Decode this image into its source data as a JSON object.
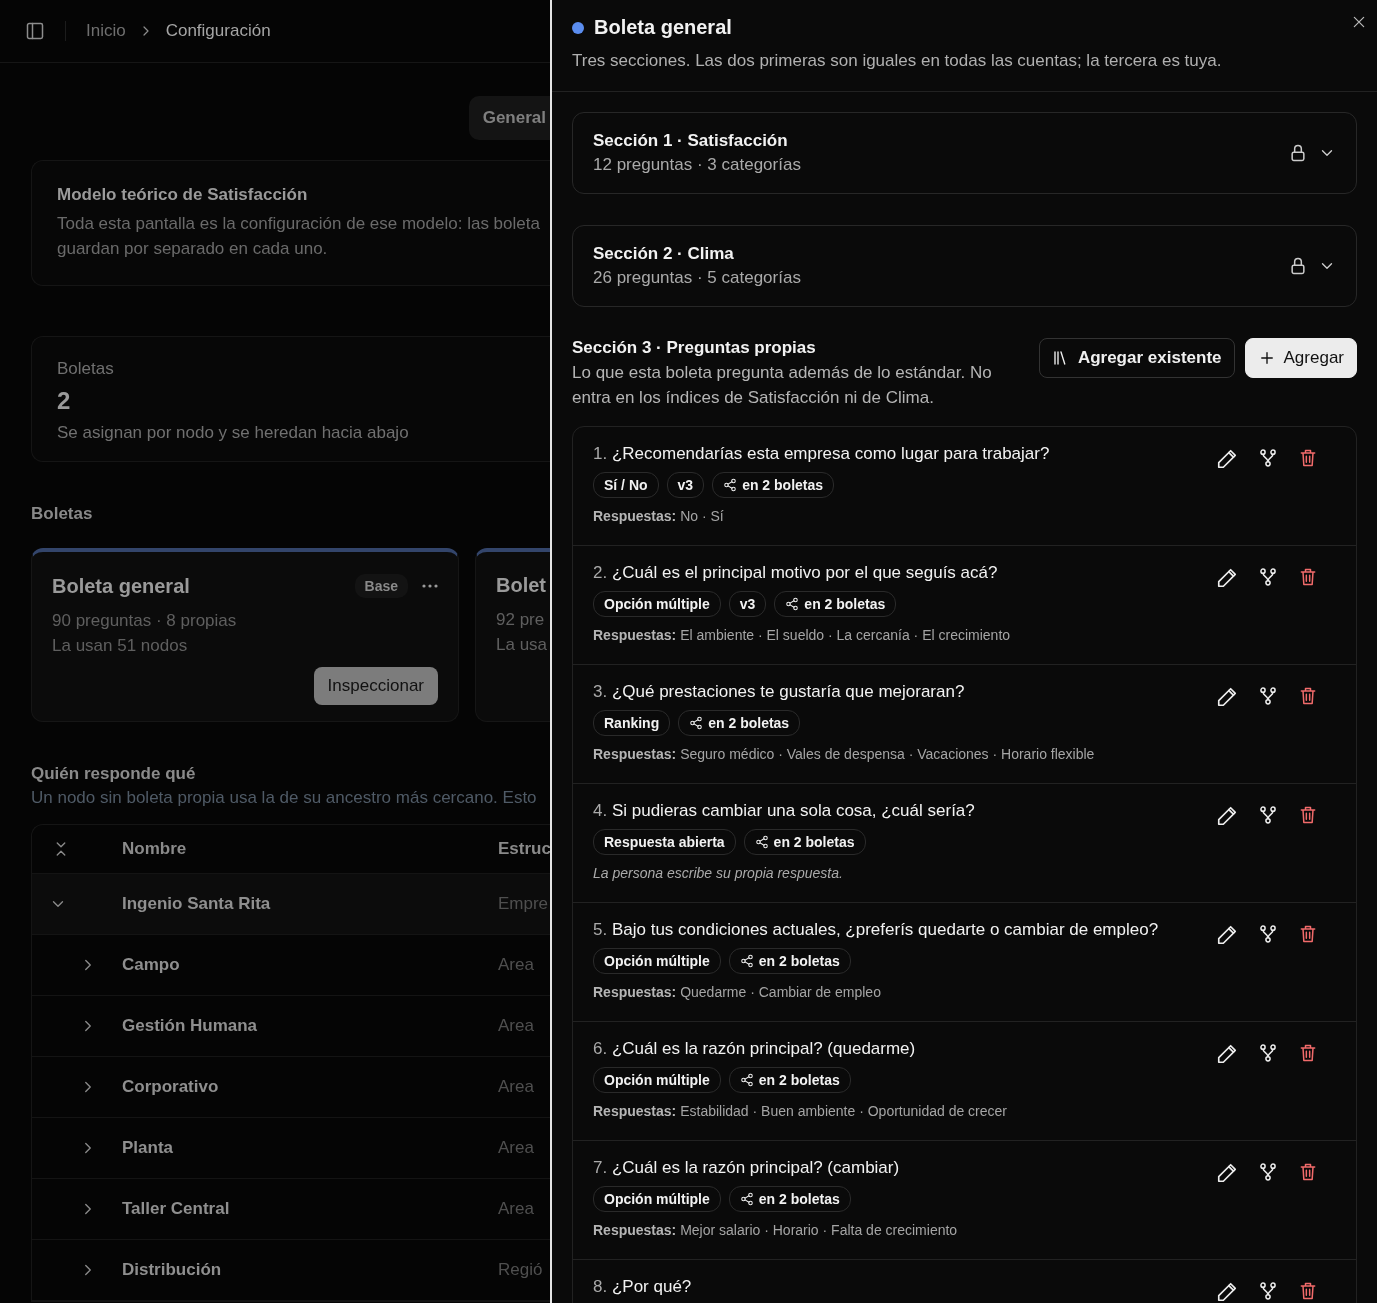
{
  "header": {
    "breadcrumbs": [
      "Inicio",
      "Configuración"
    ]
  },
  "view_tab": {
    "label": "General"
  },
  "model_card": {
    "title": "Modelo teórico de Satisfacción",
    "lines": [
      "Toda esta pantalla es la configuración de ese modelo: las boleta",
      "guardan por separado en cada uno."
    ]
  },
  "stat_card": {
    "label": "Boletas",
    "value": "2",
    "note": "Se asignan por nodo y se heredan hacia abajo"
  },
  "ballots_heading": "Boletas",
  "ballots": [
    {
      "title": "Boleta general",
      "badge": "Base",
      "meta": [
        "90 preguntas · 8 propias",
        "La usan 51 nodos"
      ],
      "action": "Inspeccionar"
    },
    {
      "title": "Bolet",
      "meta": [
        "92 pre",
        "La usa"
      ]
    }
  ],
  "assignments": {
    "title": "Quién responde qué",
    "description": "Un nodo sin boleta propia usa la de su ancestro más cercano. Esto",
    "columns": [
      "Nombre",
      "Estruc"
    ],
    "rows": [
      {
        "name": "Ingenio Santa Rita",
        "structure": "Empre",
        "expanded": true,
        "children": [
          {
            "name": "Campo",
            "structure": "Area",
            "expanded": false
          },
          {
            "name": "Gestión Humana",
            "structure": "Area",
            "expanded": false
          },
          {
            "name": "Corporativo",
            "structure": "Area",
            "expanded": false
          },
          {
            "name": "Planta",
            "structure": "Area",
            "expanded": false
          },
          {
            "name": "Taller Central",
            "structure": "Area",
            "expanded": false
          },
          {
            "name": "Distribución",
            "structure": "Regió",
            "expanded": false
          }
        ]
      }
    ]
  },
  "drawer": {
    "title": "Boleta general",
    "subtitle": "Tres secciones. Las dos primeras son iguales en todas las cuentas; la tercera es tuya.",
    "sections": [
      {
        "title": "Sección 1 · Satisfacción",
        "meta": "12 preguntas · 3 categorías",
        "locked": true,
        "expanded": false
      },
      {
        "title": "Sección 2 · Clima",
        "meta": "26 preguntas · 5 categorías",
        "locked": true,
        "expanded": false
      }
    ],
    "own_section": {
      "title": "Sección 3 · Preguntas propias",
      "description": "Lo que esta boleta pregunta además de lo estándar. No entra en los índices de Satisfacción ni de Clima.",
      "buttons": [
        {
          "label": "Agregar existente",
          "kind": "library"
        },
        {
          "label": "Agregar",
          "kind": "add"
        }
      ],
      "questions": [
        {
          "number": "1.",
          "text": "¿Recomendarías esta empresa como lugar para trabajar?",
          "tags": [
            {
              "label": "Sí / No",
              "kind": "type"
            },
            {
              "label": "v3",
              "kind": "version"
            },
            {
              "label": "en 2 boletas",
              "kind": "shared"
            }
          ],
          "answers_label": "Respuestas:",
          "answers": "No · Sí"
        },
        {
          "number": "2.",
          "text": "¿Cuál es el principal motivo por el que seguís acá?",
          "tags": [
            {
              "label": "Opción múltiple",
              "kind": "type"
            },
            {
              "label": "v3",
              "kind": "version"
            },
            {
              "label": "en 2 boletas",
              "kind": "shared"
            }
          ],
          "answers_label": "Respuestas:",
          "answers": "El ambiente · El sueldo · La cercanía · El crecimiento"
        },
        {
          "number": "3.",
          "text": "¿Qué prestaciones te gustaría que mejoraran?",
          "tags": [
            {
              "label": "Ranking",
              "kind": "type"
            },
            {
              "label": "en 2 boletas",
              "kind": "shared"
            }
          ],
          "answers_label": "Respuestas:",
          "answers": "Seguro médico · Vales de despensa · Vacaciones · Horario flexible"
        },
        {
          "number": "4.",
          "text": "Si pudieras cambiar una sola cosa, ¿cuál sería?",
          "tags": [
            {
              "label": "Respuesta abierta",
              "kind": "type"
            },
            {
              "label": "en 2 boletas",
              "kind": "shared"
            }
          ],
          "note": "La persona escribe su propia respuesta."
        },
        {
          "number": "5.",
          "text": "Bajo tus condiciones actuales, ¿preferís quedarte o cambiar de empleo?",
          "tags": [
            {
              "label": "Opción múltiple",
              "kind": "type"
            },
            {
              "label": "en 2 boletas",
              "kind": "shared"
            }
          ],
          "answers_label": "Respuestas:",
          "answers": "Quedarme · Cambiar de empleo"
        },
        {
          "number": "6.",
          "text": "¿Cuál es la razón principal? (quedarme)",
          "tags": [
            {
              "label": "Opción múltiple",
              "kind": "type"
            },
            {
              "label": "en 2 boletas",
              "kind": "shared"
            }
          ],
          "answers_label": "Respuestas:",
          "answers": "Estabilidad · Buen ambiente · Oportunidad de crecer"
        },
        {
          "number": "7.",
          "text": "¿Cuál es la razón principal? (cambiar)",
          "tags": [
            {
              "label": "Opción múltiple",
              "kind": "type"
            },
            {
              "label": "en 2 boletas",
              "kind": "shared"
            }
          ],
          "answers_label": "Respuestas:",
          "answers": "Mejor salario · Horario · Falta de crecimiento"
        },
        {
          "number": "8.",
          "text": "¿Por qué?"
        }
      ]
    }
  }
}
